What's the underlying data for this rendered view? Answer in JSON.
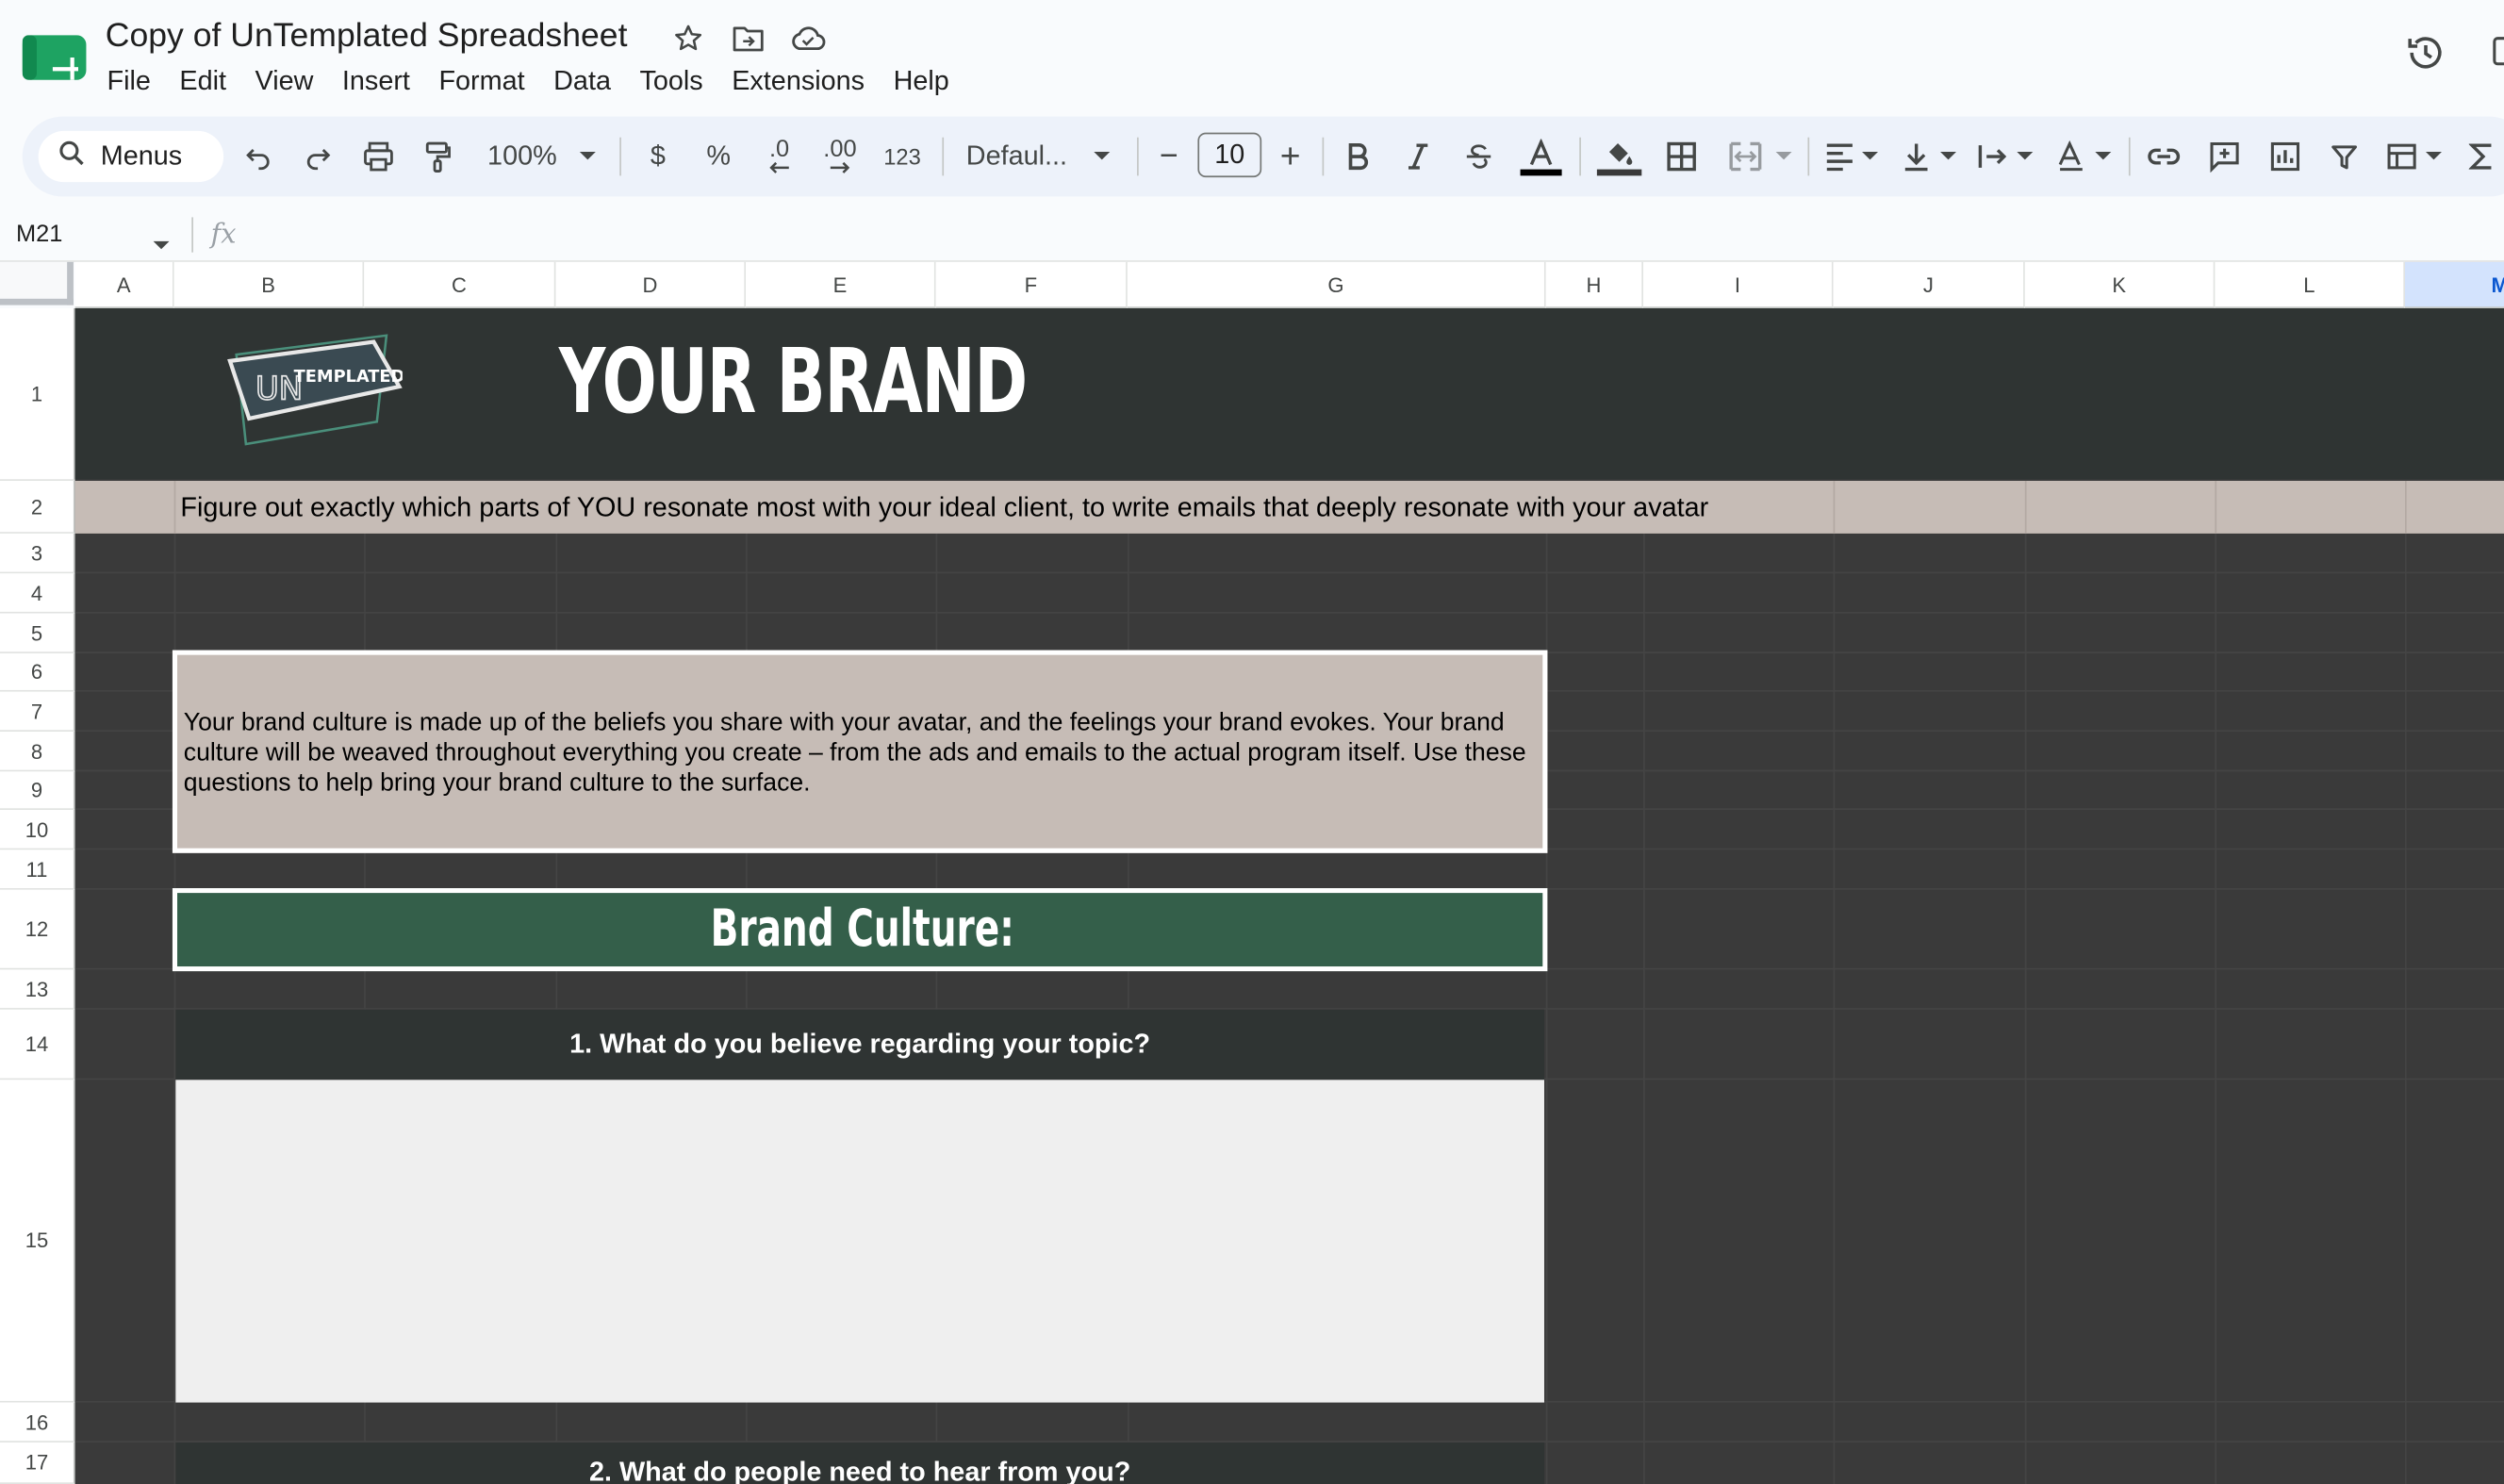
{
  "app": {
    "doc_title": "Copy of UnTemplated Spreadsheet",
    "menus": [
      "File",
      "Edit",
      "View",
      "Insert",
      "Format",
      "Data",
      "Tools",
      "Extensions",
      "Help"
    ]
  },
  "toolbar": {
    "search_label": "Menus",
    "zoom": "100%",
    "currency": "$",
    "percent": "%",
    "dec_decrease": ".0",
    "dec_increase": ".00",
    "number_format": "123",
    "font": "Defaul...",
    "font_size": "10",
    "minus": "−",
    "plus": "+"
  },
  "formula_bar": {
    "cell_ref": "M21",
    "fx": "fx",
    "value": ""
  },
  "grid": {
    "columns": [
      "A",
      "B",
      "C",
      "D",
      "E",
      "F",
      "G",
      "H",
      "I",
      "J",
      "K",
      "L",
      "M"
    ],
    "active_column": "M",
    "rows": [
      "1",
      "2",
      "3",
      "4",
      "5",
      "6",
      "7",
      "8",
      "9",
      "10",
      "11",
      "12",
      "13",
      "14",
      "15",
      "16",
      "17"
    ]
  },
  "sheet": {
    "logo_text_un": "UN",
    "logo_text_templated": "TEMPLATED",
    "brand_title": "YOUR BRAND",
    "tagline": "Figure out exactly which parts of YOU resonate most with your ideal client, to write emails that deeply resonate with your avatar",
    "intro": "Your brand culture is made up of the beliefs you share with your avatar, and the feelings your brand evokes. Your brand culture will be weaved throughout everything you create – from the ads and emails to the actual program itself. Use these questions to help bring your brand culture to the surface.",
    "section_title": "Brand Culture:",
    "question_1": "1. What do you believe regarding your topic?",
    "answer_1": "",
    "question_2": "2. What do people need to hear from you?"
  },
  "colors": {
    "sheet_background": "#3a3a3a",
    "header_band": "#2f3433",
    "tan_band": "#c6bcb6",
    "section_green": "#345f4a",
    "answer_box": "#efefef",
    "app_logo_green": "#1ea362"
  }
}
